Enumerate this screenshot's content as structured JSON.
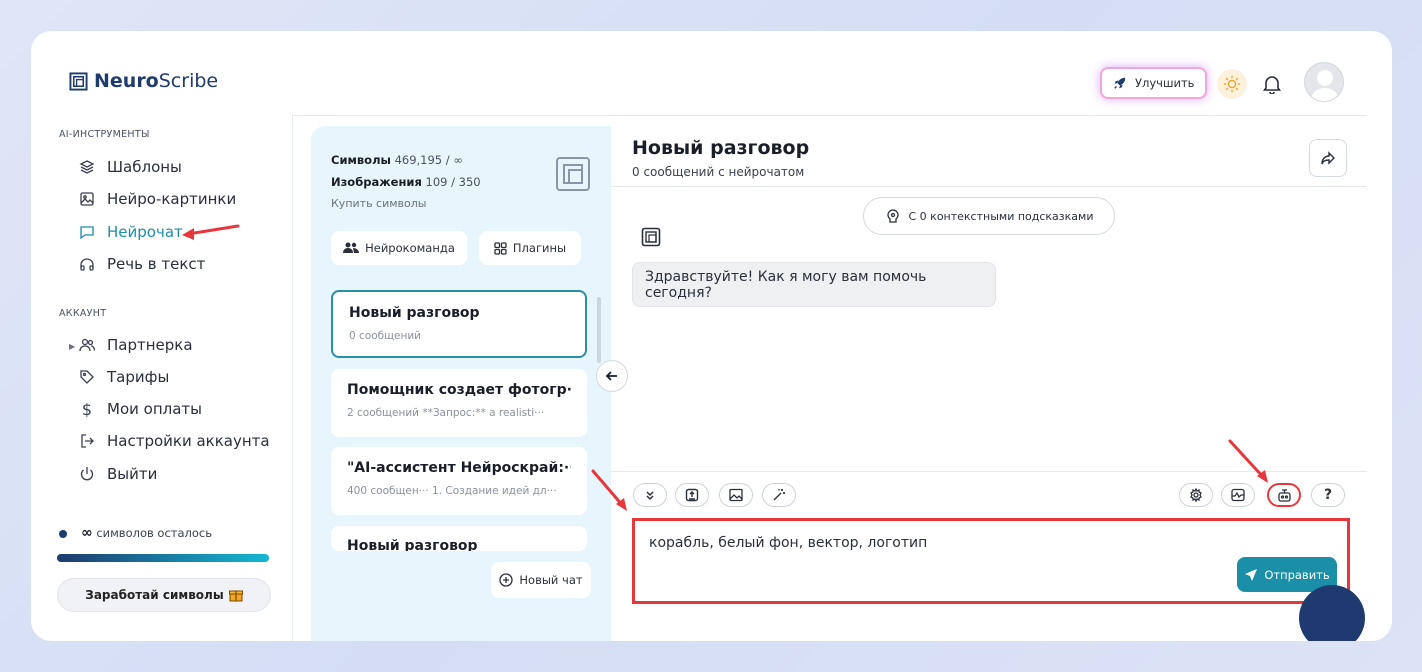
{
  "app": {
    "brand_bold": "Neuro",
    "brand_light": "Scribe"
  },
  "header": {
    "upgrade_label": "Улучшить"
  },
  "sidebar": {
    "tools_title": "AI-ИНСТРУМЕНТЫ",
    "tools": [
      {
        "label": "Шаблоны",
        "icon": "layers-icon"
      },
      {
        "label": "Нейро-картинки",
        "icon": "image-icon"
      },
      {
        "label": "Нейрочат",
        "icon": "chat-icon"
      },
      {
        "label": "Речь в текст",
        "icon": "headphones-icon"
      }
    ],
    "account_title": "АККАУНТ",
    "account": [
      {
        "label": "Партнерка",
        "icon": "users-icon"
      },
      {
        "label": "Тарифы",
        "icon": "tag-icon"
      },
      {
        "label": "Мои оплаты",
        "icon": "dollar-icon"
      },
      {
        "label": "Настройки аккаунта",
        "icon": "login-icon"
      },
      {
        "label": "Выйти",
        "icon": "power-icon"
      }
    ],
    "symbols_left_value": "∞",
    "symbols_left_label": "символов осталось",
    "earn_label": "Заработай символы"
  },
  "panel": {
    "symbols_label": "Символы",
    "symbols_value": "469,195 / ∞",
    "images_label": "Изображения",
    "images_value": "109 / 350",
    "buy_label": "Купить символы",
    "team_label": "Нейрокоманда",
    "plugins_label": "Плагины",
    "chats": [
      {
        "title": "Новый разговор",
        "subtitle": "0 сообщений"
      },
      {
        "title": "Помощник создает фотогр···",
        "subtitle": "2 сообщений    **Запрос:** a realisti···"
      },
      {
        "title": "\"AI-ассистент Нейроскрай:···",
        "subtitle": "400 сообщен··· 1. Создание идей дл···"
      },
      {
        "title": "Новый разговор",
        "subtitle": ""
      }
    ],
    "new_chat_label": "Новый чат"
  },
  "conversation": {
    "title": "Новый разговор",
    "subtitle": "0 сообщений с нейрочатом",
    "context_label": "С 0 контекстными подсказками",
    "bot_message": "Здравствуйте! Как я могу вам помочь сегодня?",
    "input_value": "корабль, белый фон, вектор, логотип",
    "send_label": "Отправить",
    "help_label": "?"
  },
  "colors": {
    "accent": "#1b8fa8",
    "brand": "#1e3a6e",
    "annotation": "#e6383c"
  }
}
